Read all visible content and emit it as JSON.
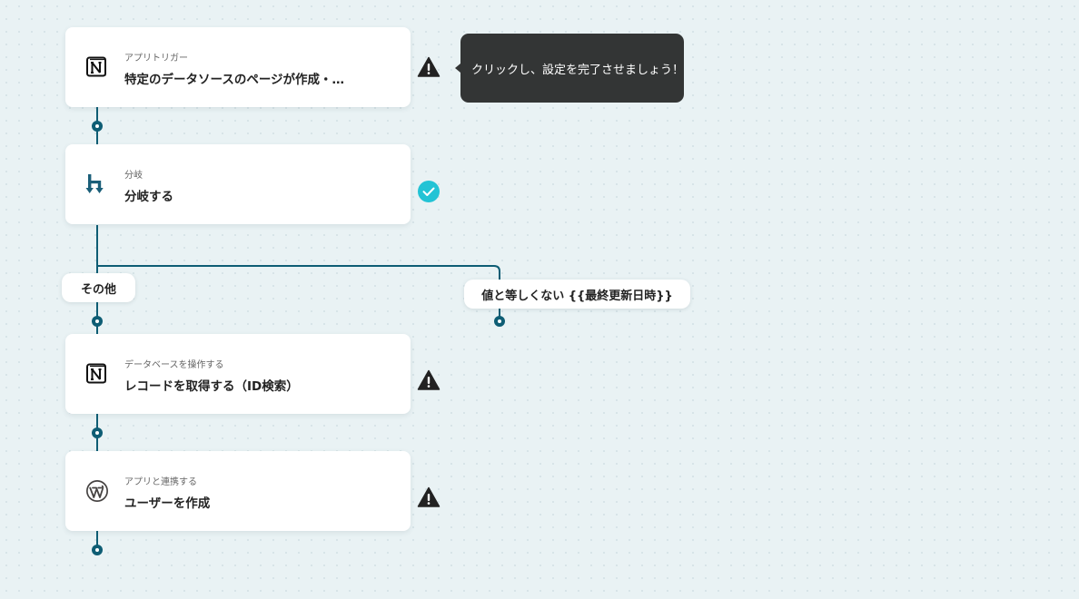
{
  "steps": [
    {
      "kind": "アプリトリガー",
      "title": "特定のデータソースのページが作成・…",
      "app_icon": "notion-icon",
      "status": "warning"
    },
    {
      "kind": "分岐",
      "title": "分岐する",
      "app_icon": "branch-icon",
      "status": "complete"
    },
    {
      "kind": "データベースを操作する",
      "title": "レコードを取得する（ID検索）",
      "app_icon": "notion-icon",
      "status": "warning"
    },
    {
      "kind": "アプリと連携する",
      "title": "ユーザーを作成",
      "app_icon": "wordpress-icon",
      "status": "warning"
    }
  ],
  "tooltip": {
    "text": "クリックし、設定を完了させましょう！"
  },
  "branches": {
    "left_label": "その他",
    "right_label": "値と等しくない {{最終更新日時}}"
  },
  "colors": {
    "background": "#e9f2f4",
    "connector": "#0e5d74",
    "branch_icon": "#1b5f79",
    "check": "#22c3d5",
    "warning": "#222222",
    "tooltip_bg": "#333535"
  }
}
